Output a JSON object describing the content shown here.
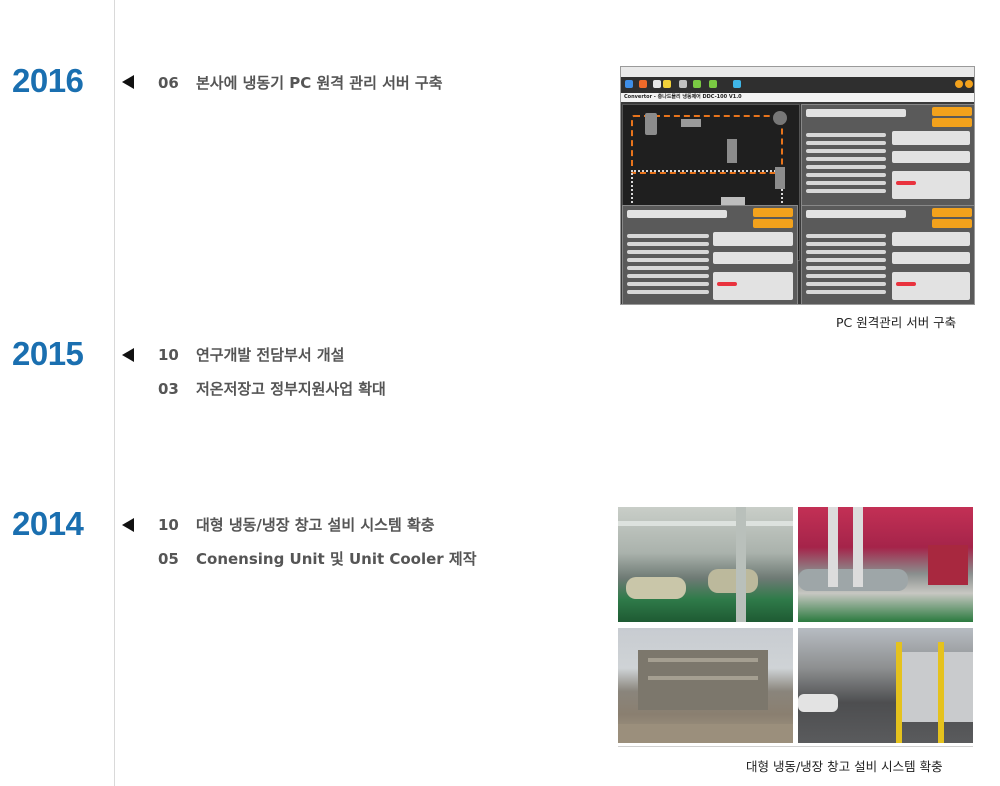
{
  "timeline": [
    {
      "year": "2016",
      "entries": [
        {
          "month": "06",
          "text": "본사에 냉동기 PC 원격 관리 서버 구축"
        }
      ],
      "caption": "PC 원격관리 서버 구축"
    },
    {
      "year": "2015",
      "entries": [
        {
          "month": "10",
          "text": "연구개발 전담부서 개설"
        },
        {
          "month": "03",
          "text": "저온저장고 정부지원사업 확대"
        }
      ]
    },
    {
      "year": "2014",
      "entries": [
        {
          "month": "10",
          "text": "대형 냉동/냉장 창고 설비 시스템 확충"
        },
        {
          "month": "05",
          "text": "Conensing Unit 및 Unit Cooler 제작"
        }
      ],
      "caption": "대형 냉동/냉장 창고 설비 시스템 확충"
    }
  ],
  "scada": {
    "app_title": "Convertor - 충나드몰리 냉동제어 DDC-100 V1.0",
    "zones": [
      "1호기",
      "2호기",
      "3호기"
    ],
    "values": [
      "23℃",
      "36.5℃",
      "26.5℃",
      "9℃"
    ]
  },
  "colors": {
    "year": "#1a6fb0",
    "entry_text": "#555555",
    "timeline_line": "#d9d9d9",
    "scada_accent": "#f3a21c"
  }
}
